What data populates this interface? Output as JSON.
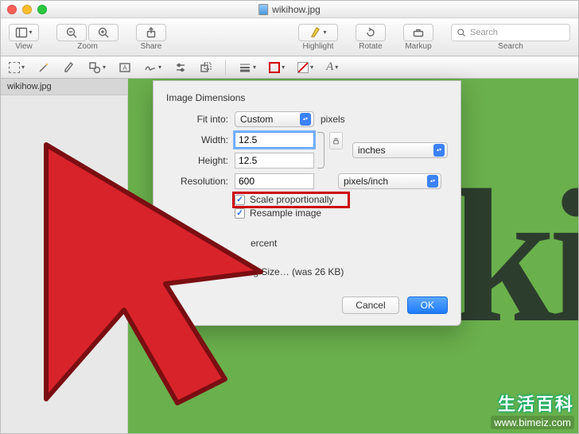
{
  "window": {
    "filename": "wikihow.jpg"
  },
  "toolbar": {
    "view": "View",
    "zoom": "Zoom",
    "share": "Share",
    "highlight": "Highlight",
    "rotate": "Rotate",
    "markup": "Markup",
    "search_label": "Search",
    "search_placeholder": "Search"
  },
  "sidebar": {
    "item0": "wikihow.jpg"
  },
  "dialog": {
    "title": "Image Dimensions",
    "fit_into_label": "Fit into:",
    "fit_into_value": "Custom",
    "fit_into_unit": "pixels",
    "width_label": "Width:",
    "width_value": "12.5",
    "height_label": "Height:",
    "height_value": "12.5",
    "wh_unit": "inches",
    "resolution_label": "Resolution:",
    "resolution_value": "600",
    "resolution_unit": "pixels/inch",
    "scale_proportionally": "Scale proportionally",
    "resample_image": "Resample image",
    "percent": "ercent",
    "resulting_size": "ating Size… (was 26 KB)",
    "cancel": "Cancel",
    "ok": "OK"
  },
  "watermark": {
    "line1": "生活百科",
    "line2": "www.bimeiz.com"
  }
}
